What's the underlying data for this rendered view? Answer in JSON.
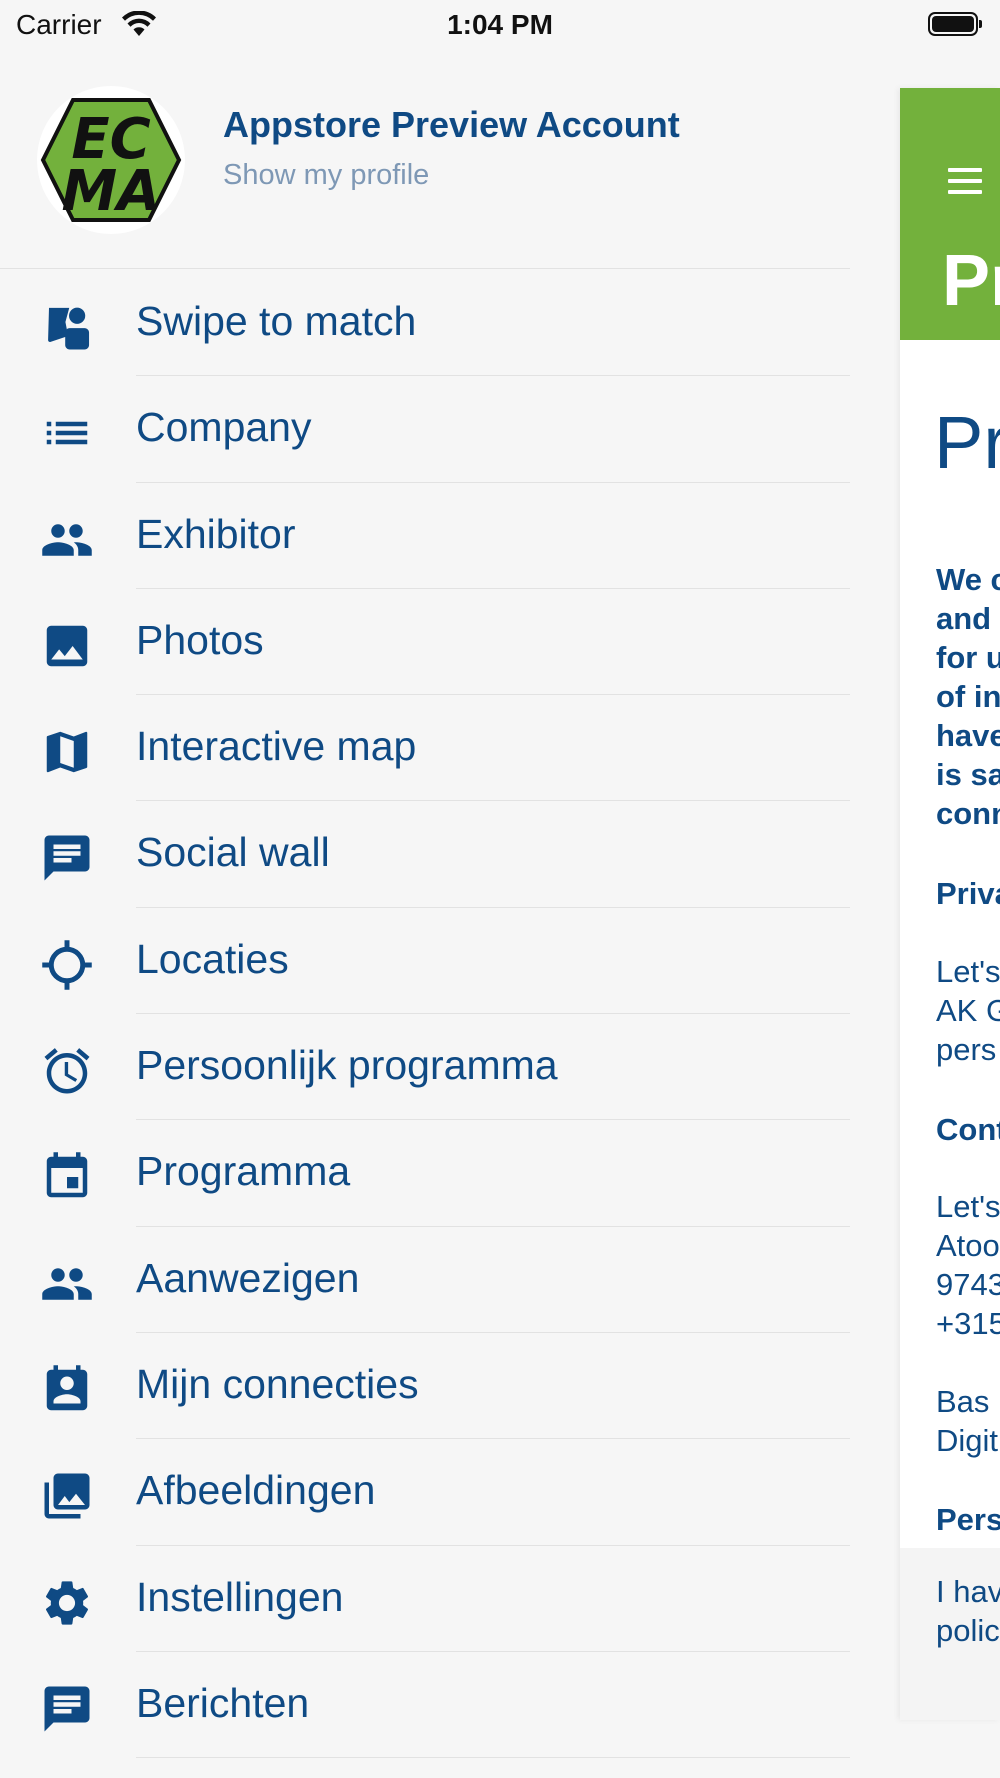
{
  "status_bar": {
    "carrier": "Carrier",
    "time": "1:04 PM"
  },
  "profile": {
    "name": "Appstore Preview Account",
    "link": "Show my profile",
    "logo_text_top": "EC",
    "logo_text_bottom": "MA"
  },
  "menu": {
    "items": [
      {
        "label": "Swipe to match",
        "icon": "swipe-icon"
      },
      {
        "label": "Company",
        "icon": "list-icon"
      },
      {
        "label": "Exhibitor",
        "icon": "people-icon"
      },
      {
        "label": "Photos",
        "icon": "image-icon"
      },
      {
        "label": "Interactive map",
        "icon": "map-icon"
      },
      {
        "label": "Social wall",
        "icon": "message-icon"
      },
      {
        "label": "Locaties",
        "icon": "crosshair-icon"
      },
      {
        "label": "Persoonlijk programma",
        "icon": "alarm-clock-icon"
      },
      {
        "label": "Programma",
        "icon": "calendar-icon"
      },
      {
        "label": "Aanwezigen",
        "icon": "people-icon"
      },
      {
        "label": "Mijn connecties",
        "icon": "contact-card-icon"
      },
      {
        "label": "Afbeeldingen",
        "icon": "image-library-icon"
      },
      {
        "label": "Instellingen",
        "icon": "gear-icon"
      },
      {
        "label": "Berichten",
        "icon": "message-icon"
      }
    ]
  },
  "content": {
    "header_title": "Pr",
    "heading": "Pr",
    "intro_lines": [
      "We c",
      "and",
      "for u",
      "of in",
      "have",
      "is sa",
      "conn"
    ],
    "section1_title": "Priva",
    "section1_lines": [
      "Let's",
      "AK G",
      "pers"
    ],
    "section2_title": "Cont",
    "section2_lines": [
      "Let's",
      "Atoo",
      "9743",
      "+315"
    ],
    "section3_lines": [
      "Bas",
      "Digit"
    ],
    "section4_title": "Pers",
    "footer_lines": [
      "I hav",
      "polic"
    ]
  },
  "colors": {
    "accent_green": "#73b13c",
    "text_blue": "#0f4a84",
    "muted_blue": "#7e98b5",
    "background": "#f6f6f6"
  }
}
